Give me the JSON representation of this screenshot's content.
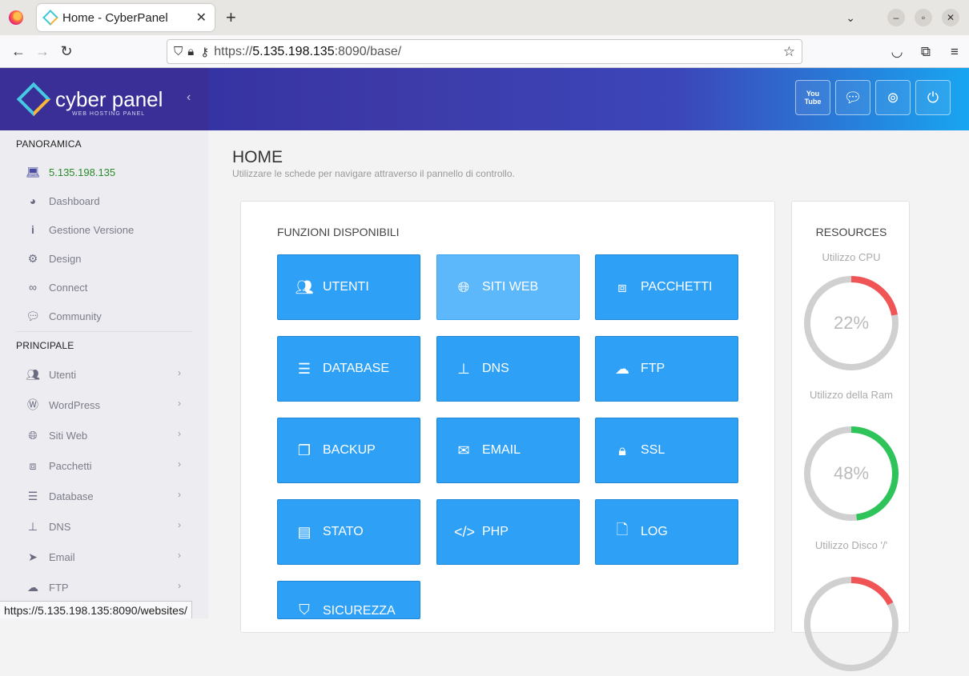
{
  "browser": {
    "tab_title": "Home - CyberPanel",
    "url_prefix": "https://",
    "url_host": "5.135.198.135",
    "url_rest": ":8090/base/",
    "status_url": "https://5.135.198.135:8090/websites/"
  },
  "brand": {
    "name": "cyber panel",
    "tagline": "WEB HOSTING PANEL"
  },
  "header": {
    "buttons": [
      {
        "icon": "youtube-icon",
        "label": "You\nTube"
      },
      {
        "icon": "chat-icon"
      },
      {
        "icon": "lifebuoy-icon"
      },
      {
        "icon": "power-icon"
      }
    ]
  },
  "sidebar": {
    "section_overview": "PANORAMICA",
    "overview_items": [
      {
        "label": "5.135.198.135",
        "icon": "laptop-icon"
      },
      {
        "label": "Dashboard",
        "icon": "dashboard-icon"
      },
      {
        "label": "Gestione Versione",
        "icon": "info-icon"
      },
      {
        "label": "Design",
        "icon": "gear-icon"
      },
      {
        "label": "Connect",
        "icon": "link-icon"
      },
      {
        "label": "Community",
        "icon": "comments-icon"
      }
    ],
    "section_main": "PRINCIPALE",
    "main_items": [
      {
        "label": "Utenti",
        "icon": "users-icon"
      },
      {
        "label": "WordPress",
        "icon": "wordpress-icon"
      },
      {
        "label": "Siti Web",
        "icon": "globe-icon"
      },
      {
        "label": "Pacchetti",
        "icon": "cubes-icon"
      },
      {
        "label": "Database",
        "icon": "database-icon"
      },
      {
        "label": "DNS",
        "icon": "sitemap-icon"
      },
      {
        "label": "Email",
        "icon": "paper-plane-icon"
      },
      {
        "label": "FTP",
        "icon": "cloud-upload-icon"
      }
    ]
  },
  "main": {
    "title": "HOME",
    "subtitle": "Utilizzare le schede per navigare attraverso il pannello di controllo.",
    "functions_title": "FUNZIONI DISPONIBILI",
    "tiles": [
      {
        "label": "UTENTI",
        "icon": "users-icon"
      },
      {
        "label": "SITI WEB",
        "icon": "globe-icon"
      },
      {
        "label": "PACCHETTI",
        "icon": "cubes-icon"
      },
      {
        "label": "DATABASE",
        "icon": "database-icon"
      },
      {
        "label": "DNS",
        "icon": "sitemap-icon"
      },
      {
        "label": "FTP",
        "icon": "cloud-upload-icon"
      },
      {
        "label": "BACKUP",
        "icon": "copy-icon"
      },
      {
        "label": "EMAIL",
        "icon": "envelope-icon"
      },
      {
        "label": "SSL",
        "icon": "lock-icon"
      },
      {
        "label": "STATO",
        "icon": "server-icon"
      },
      {
        "label": "PHP",
        "icon": "code-icon"
      },
      {
        "label": "LOG",
        "icon": "file-icon"
      },
      {
        "label": "SICUREZZA",
        "icon": "shield-icon"
      }
    ]
  },
  "resources": {
    "title": "RESOURCES",
    "cpu_label": "Utilizzo CPU",
    "cpu_value": "22%",
    "cpu_pct": 22,
    "ram_label": "Utilizzo della Ram",
    "ram_value": "48%",
    "ram_pct": 48,
    "disk_label": "Utilizzo Disco '/'",
    "colors": {
      "cpu": "#f05454",
      "ram": "#2ec45a",
      "track": "#d0d0d0"
    }
  }
}
